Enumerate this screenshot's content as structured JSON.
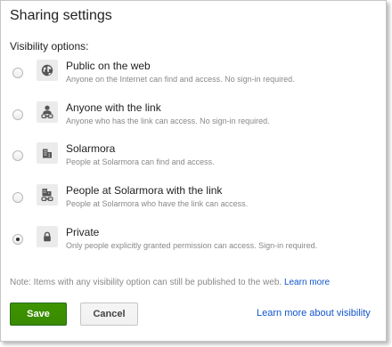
{
  "dialog": {
    "title": "Sharing settings",
    "section_label": "Visibility options:"
  },
  "options": [
    {
      "title": "Public on the web",
      "description": "Anyone on the Internet can find and access. No sign-in required.",
      "icon": "globe-icon",
      "selected": false
    },
    {
      "title": "Anyone with the link",
      "description": "Anyone who has the link can access. No sign-in required.",
      "icon": "person-link-icon",
      "selected": false
    },
    {
      "title": "Solarmora",
      "description": "People at Solarmora can find and access.",
      "icon": "building-icon",
      "selected": false
    },
    {
      "title": "People at Solarmora with the link",
      "description": "People at Solarmora who have the link can access.",
      "icon": "building-link-icon",
      "selected": false
    },
    {
      "title": "Private",
      "description": "Only people explicitly granted permission can access. Sign-in required.",
      "icon": "lock-icon",
      "selected": true
    }
  ],
  "note": {
    "text": "Note: Items with any visibility option can still be published to the web.",
    "link": "Learn more"
  },
  "buttons": {
    "save": "Save",
    "cancel": "Cancel"
  },
  "footer_link": "Learn more about visibility",
  "colors": {
    "save_green": "#3d9400",
    "link_blue": "#1155cc",
    "muted_text": "#888888"
  }
}
